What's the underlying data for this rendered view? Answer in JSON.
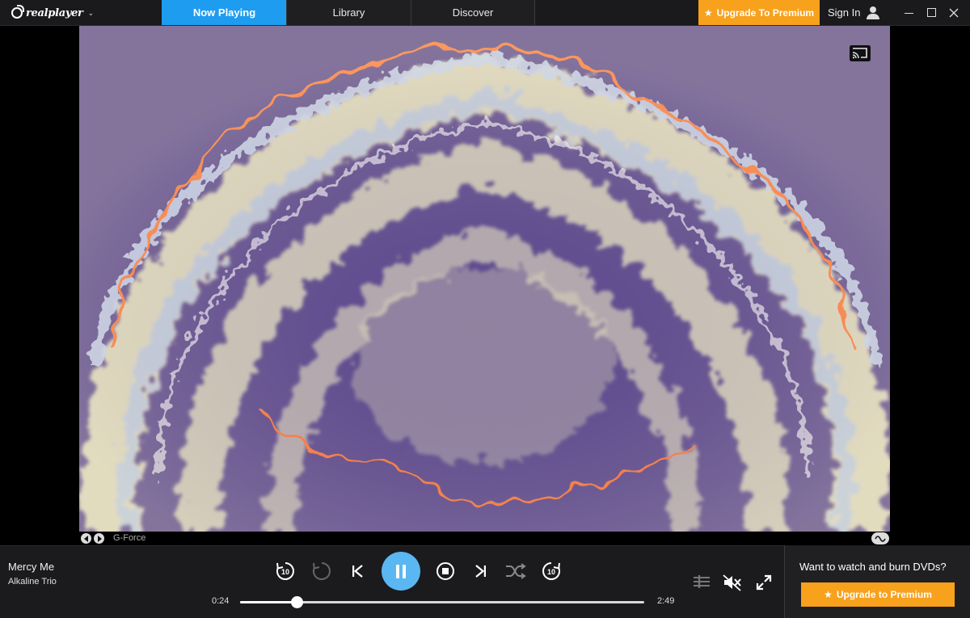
{
  "app": {
    "logo_text": "realplayer",
    "accent_color": "#1e9cf0",
    "premium_color": "#f8a11c"
  },
  "tabs": [
    {
      "label": "Now Playing",
      "active": true
    },
    {
      "label": "Library",
      "active": false
    },
    {
      "label": "Discover",
      "active": false
    }
  ],
  "header": {
    "upgrade_label": "Upgrade To Premium",
    "signin_label": "Sign In"
  },
  "visualizer": {
    "name": "G-Force",
    "background_color": "#5e4a8e"
  },
  "now_playing": {
    "title": "Mercy Me",
    "artist": "Alkaline Trio",
    "elapsed": "0:24",
    "duration": "2:49",
    "progress_fraction": 0.142
  },
  "controls": {
    "skip_back_seconds": "10",
    "skip_forward_seconds": "10"
  },
  "promo": {
    "text": "Want to watch and burn DVDs?",
    "button_label": "Upgrade to Premium"
  },
  "icons": {
    "cast": "cast-icon",
    "rewind": "rewind-10-icon",
    "replay": "replay-icon",
    "previous": "previous-track-icon",
    "pause": "pause-icon",
    "stop": "stop-icon",
    "next": "next-track-icon",
    "shuffle": "shuffle-icon",
    "forward": "forward-10-icon",
    "equalizer": "equalizer-icon",
    "volume": "volume-muted-icon",
    "fullscreen": "fullscreen-icon"
  }
}
